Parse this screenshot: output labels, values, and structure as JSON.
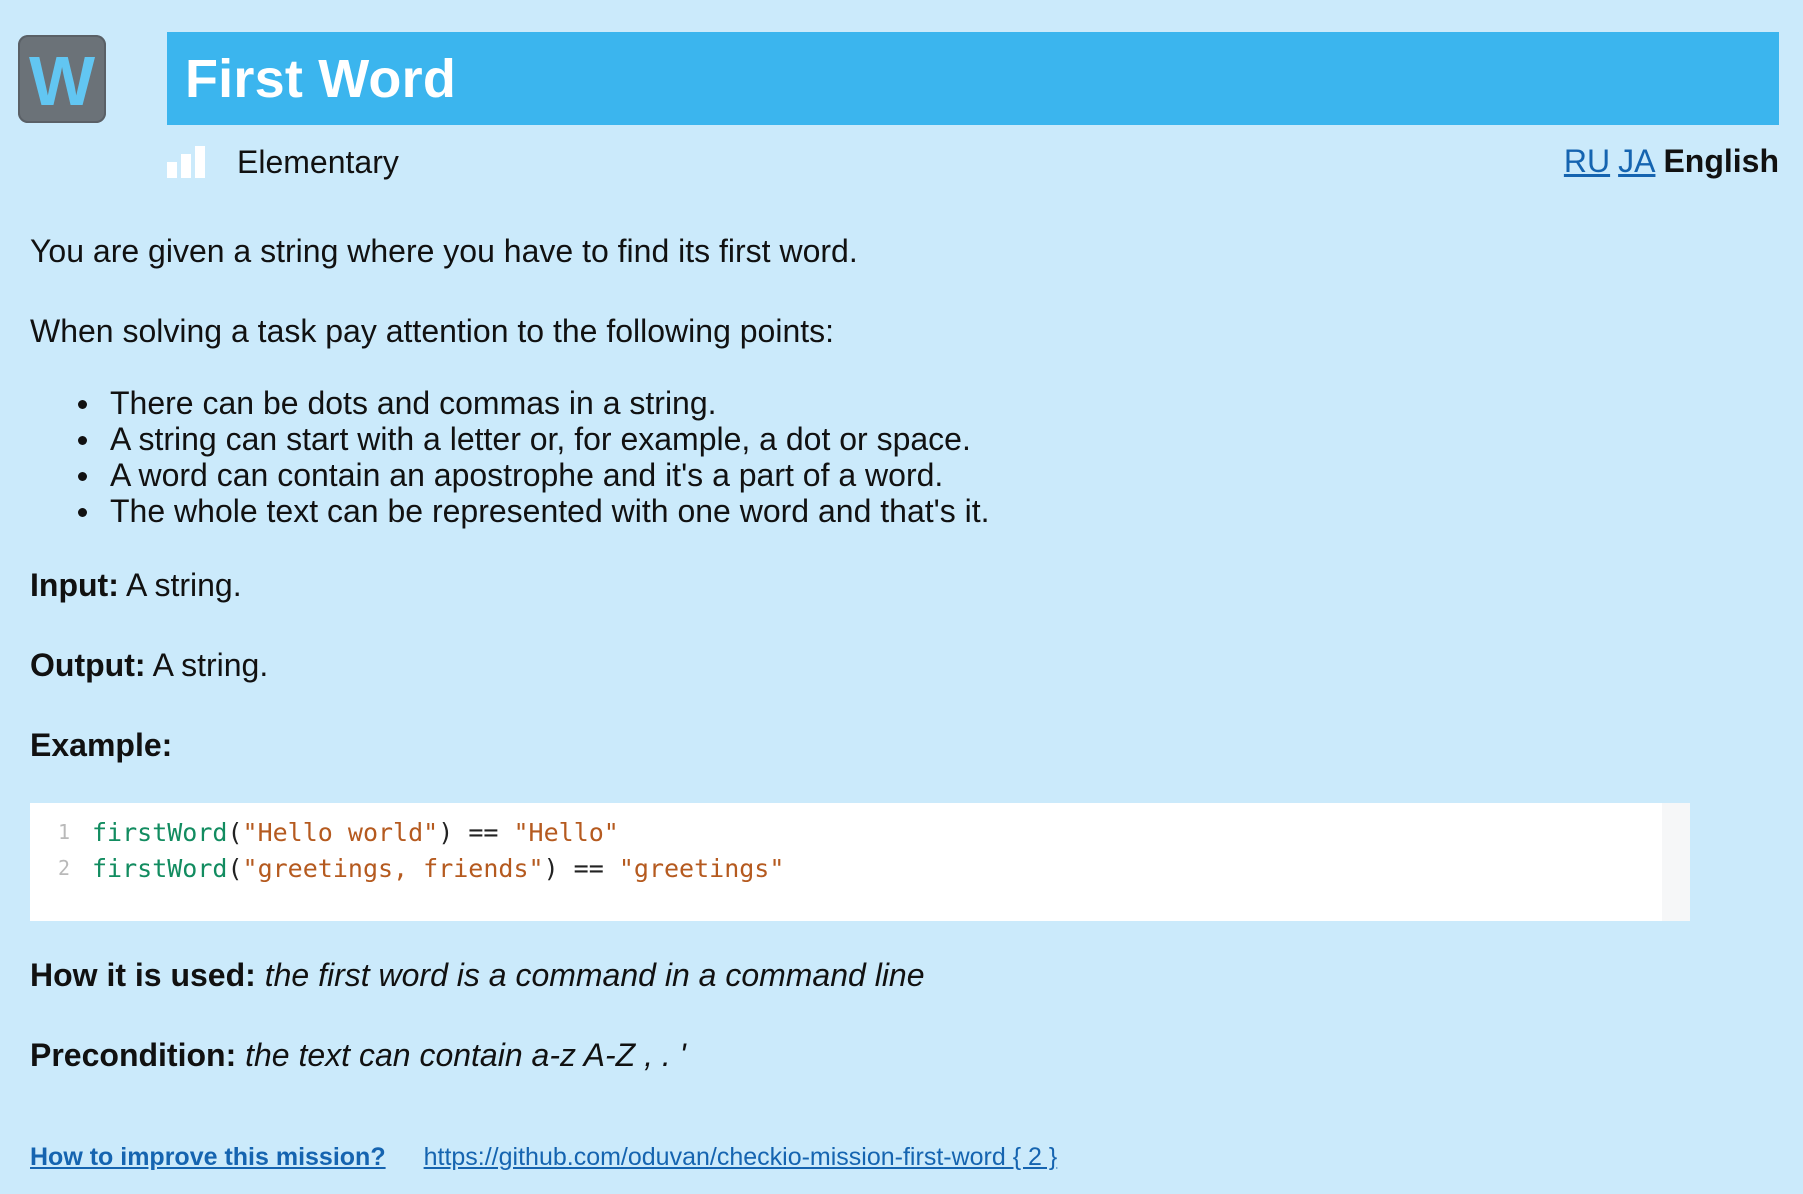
{
  "logo": {
    "letter": "W"
  },
  "title": "First Word",
  "difficulty": {
    "label": "Elementary"
  },
  "languages": {
    "links": [
      "RU",
      "JA"
    ],
    "current": "English"
  },
  "description": {
    "intro": "You are given a string where you have to find its first word.",
    "points_intro": "When solving a task pay attention to the following points:",
    "points": [
      "There can be dots and commas in a string.",
      "A string can start with a letter or, for example, a dot or space.",
      "A word can contain an apostrophe and it's a part of a word.",
      "The whole text can be represented with one word and that's it."
    ],
    "input_label": "Input:",
    "input_text": " A string.",
    "output_label": "Output:",
    "output_text": " A string.",
    "example_label": "Example:"
  },
  "code": {
    "lines": [
      {
        "number": "1",
        "fn": "firstWord",
        "open": "(",
        "arg": "\"Hello world\"",
        "close": ")",
        "op": " == ",
        "result": "\"Hello\""
      },
      {
        "number": "2",
        "fn": "firstWord",
        "open": "(",
        "arg": "\"greetings, friends\"",
        "close": ")",
        "op": " == ",
        "result": "\"greetings\""
      }
    ]
  },
  "usage": {
    "label": "How it is used:",
    "text": " the first word is a command in a command line"
  },
  "precondition": {
    "label": "Precondition:",
    "text": " the text can contain a-z A-Z , . '"
  },
  "footer": {
    "improve_link": "How to improve this mission?",
    "repo_link": "https://github.com/oduvan/checkio-mission-first-word { 2 }"
  },
  "colors": {
    "background": "#cbeafb",
    "title_bar": "#3bb5ee",
    "link": "#1564b0",
    "code_function": "#128c60",
    "code_string": "#b55a1f"
  }
}
